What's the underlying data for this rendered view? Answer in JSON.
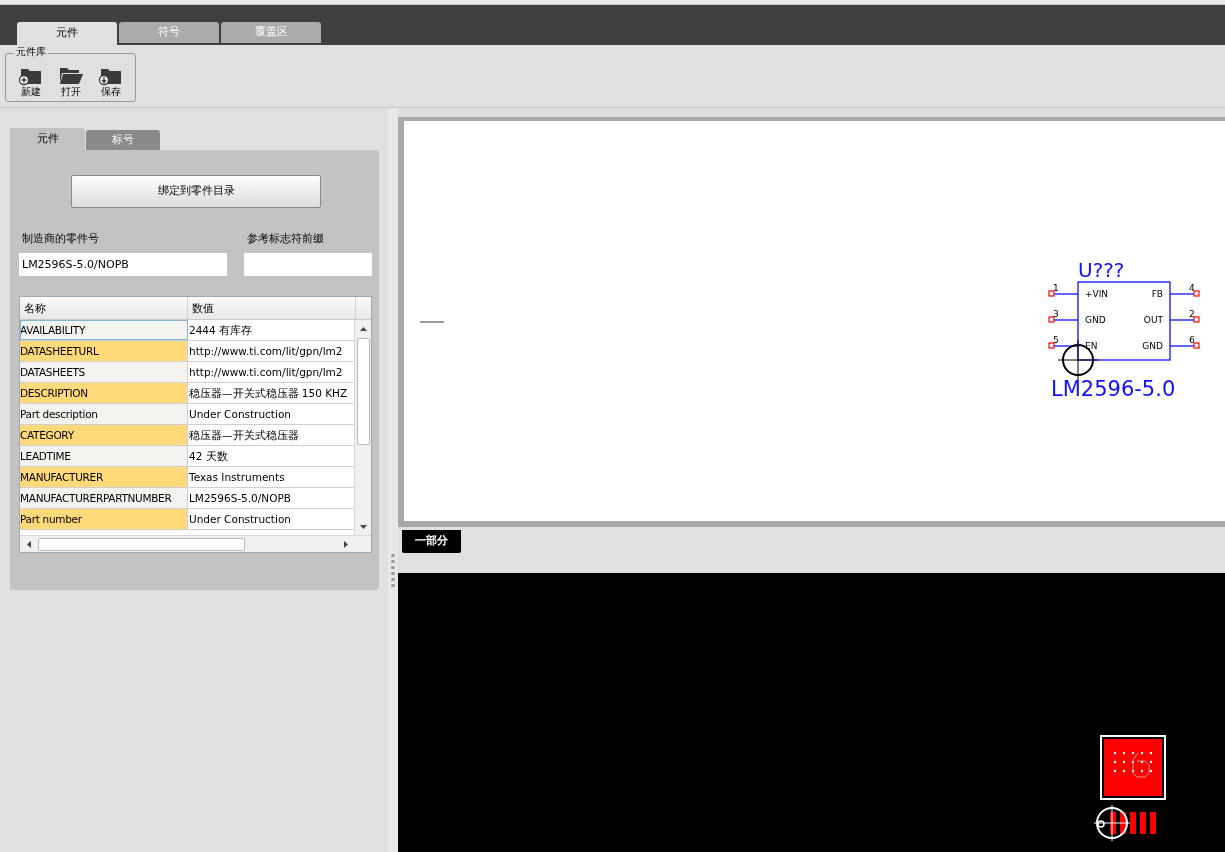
{
  "main_tabs": [
    {
      "label": "元件",
      "selected": true
    },
    {
      "label": "符号",
      "selected": false
    },
    {
      "label": "覆盖区",
      "selected": false
    }
  ],
  "toolbar": {
    "group_label": "元件库",
    "buttons": [
      {
        "kind": "new",
        "label": "新建"
      },
      {
        "kind": "open",
        "label": "打开"
      },
      {
        "kind": "save",
        "label": "保存"
      }
    ]
  },
  "panel_tabs": [
    {
      "label": "元件",
      "selected": true
    },
    {
      "label": "标号",
      "selected": false
    }
  ],
  "bind_button": "绑定到零件目录",
  "fields": [
    {
      "label": "制造商的零件号",
      "value": "LM2596S-5.0/NOPB"
    },
    {
      "label": "参考标志符前缀"
    }
  ],
  "table": {
    "columns": [
      "名称",
      "数值"
    ],
    "rows": [
      {
        "name": "AVAILABILITY",
        "value": "2444 有库存",
        "highlighted": false,
        "selected": true
      },
      {
        "name": "DATASHEETURL",
        "value": "http://www.ti.com/lit/gpn/lm2",
        "highlighted": true,
        "selected": false
      },
      {
        "name": "DATASHEETS",
        "value": "http://www.ti.com/lit/gpn/lm2",
        "highlighted": false,
        "selected": false
      },
      {
        "name": "DESCRIPTION",
        "value": "稳压器—开关式稳压器 150 KHZ",
        "highlighted": true,
        "selected": false
      },
      {
        "name": "Part description",
        "value": "Under Construction",
        "highlighted": false,
        "selected": false
      },
      {
        "name": "CATEGORY",
        "value": "稳压器—开关式稳压器",
        "highlighted": true,
        "selected": false
      },
      {
        "name": "LEADTIME",
        "value": "42 天数",
        "highlighted": false,
        "selected": false
      },
      {
        "name": "MANUFACTURER",
        "value": "Texas Instruments",
        "highlighted": true,
        "selected": false
      },
      {
        "name": "MANUFACTURERPARTNUMBER",
        "value": "LM2596S-5.0/NOPB",
        "highlighted": false,
        "selected": false
      },
      {
        "name": "Part number",
        "value": "Under Construction",
        "highlighted": true,
        "selected": false
      }
    ]
  },
  "schematic": {
    "designator": "U???",
    "part_name": "LM2596-5.0",
    "left_pins": [
      {
        "number": "1",
        "label": "+VIN"
      },
      {
        "number": "3",
        "label": "GND"
      },
      {
        "number": "5",
        "label": "EN"
      }
    ],
    "right_pins": [
      {
        "number": "4",
        "label": "FB"
      },
      {
        "number": "2",
        "label": "OUT"
      },
      {
        "number": "6",
        "label": "GND"
      }
    ]
  },
  "section_button": "一部分"
}
